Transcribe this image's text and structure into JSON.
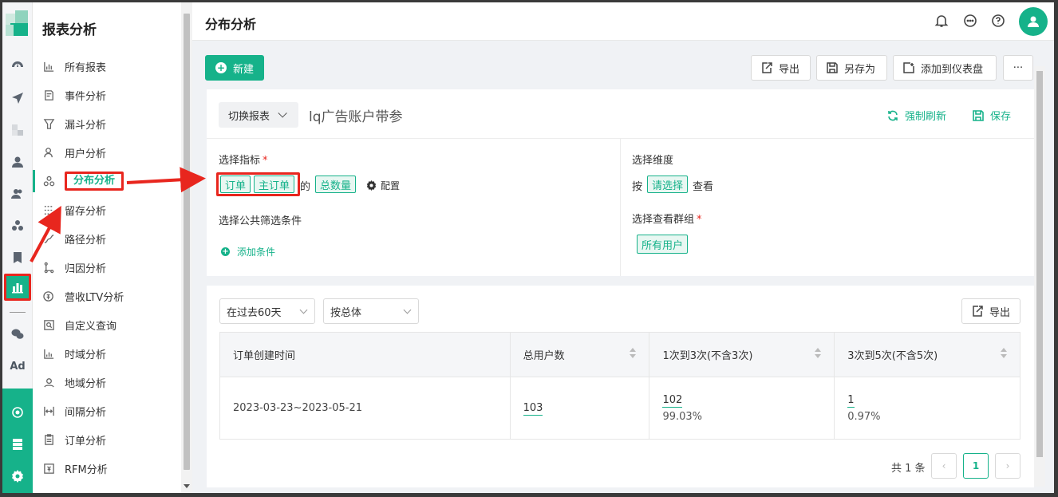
{
  "sidebar": {
    "title": "报表分析",
    "items": [
      {
        "label": "所有报表",
        "icon": "bar-chart-icon"
      },
      {
        "label": "事件分析",
        "icon": "event-icon"
      },
      {
        "label": "漏斗分析",
        "icon": "funnel-icon"
      },
      {
        "label": "用户分析",
        "icon": "user-icon"
      },
      {
        "label": "分布分析",
        "icon": "distribution-icon",
        "active": true
      },
      {
        "label": "留存分析",
        "icon": "grid-icon"
      },
      {
        "label": "路径分析",
        "icon": "path-icon"
      },
      {
        "label": "归因分析",
        "icon": "attribution-icon"
      },
      {
        "label": "营收LTV分析",
        "icon": "revenue-icon"
      },
      {
        "label": "自定义查询",
        "icon": "query-icon"
      },
      {
        "label": "时域分析",
        "icon": "time-chart-icon"
      },
      {
        "label": "地域分析",
        "icon": "location-icon"
      },
      {
        "label": "间隔分析",
        "icon": "interval-icon"
      },
      {
        "label": "订单分析",
        "icon": "order-icon"
      },
      {
        "label": "RFM分析",
        "icon": "rfm-icon"
      }
    ]
  },
  "rail": {
    "ad_label": "Ad",
    "accent": "#16b28a",
    "highlight": "#e8261e"
  },
  "header": {
    "title": "分布分析"
  },
  "toolbar": {
    "new_label": "新建",
    "export_label": "导出",
    "save_as_label": "另存为",
    "add_dashboard_label": "添加到仪表盘",
    "more_label": "···"
  },
  "report": {
    "switch_label": "切换报表",
    "name": "lq广告账户带参",
    "refresh_label": "强制刷新",
    "save_label": "保存"
  },
  "config": {
    "metric_label": "选择指标",
    "required_mark": "*",
    "metric_tag_1": "订单",
    "metric_tag_2": "主订单",
    "of_word": "的",
    "metric_tag_3": "总数量",
    "configure_label": "配置",
    "filter_label": "选择公共筛选条件",
    "add_condition_label": "添加条件",
    "dimension_label": "选择维度",
    "by_word": "按",
    "dimension_placeholder": "请选择",
    "view_word": "查看",
    "group_label": "选择查看群组",
    "group_tag": "所有用户"
  },
  "results": {
    "time_range": "在过去60天",
    "aggregation": "按总体",
    "export_label": "导出",
    "columns": [
      "订单创建时间",
      "总用户数",
      "1次到3次(不含3次)",
      "3次到5次(不含5次)"
    ],
    "rows": [
      {
        "period": "2023-03-23~2023-05-21",
        "total": "103",
        "bucket1_count": "102",
        "bucket1_pct": "99.03%",
        "bucket2_count": "1",
        "bucket2_pct": "0.97%"
      }
    ],
    "pager_total": "共 1 条",
    "pager_prev": "‹",
    "pager_current": "1",
    "pager_next": "›"
  }
}
